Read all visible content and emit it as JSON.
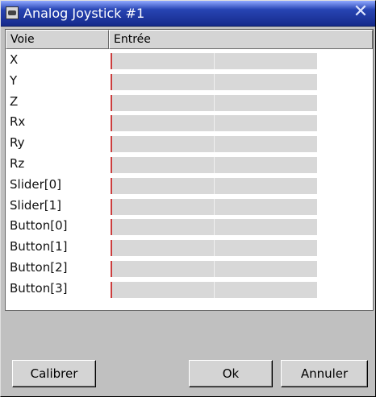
{
  "window": {
    "title": "Analog Joystick #1"
  },
  "list": {
    "headers": {
      "voie": "Voie",
      "entree": "Entrée"
    },
    "rows": [
      {
        "label": "X",
        "level": 0.0
      },
      {
        "label": "Y",
        "level": 0.0
      },
      {
        "label": "Z",
        "level": 0.0
      },
      {
        "label": "Rx",
        "level": 0.0
      },
      {
        "label": "Ry",
        "level": 0.0
      },
      {
        "label": "Rz",
        "level": 0.0
      },
      {
        "label": "Slider[0]",
        "level": 0.0
      },
      {
        "label": "Slider[1]",
        "level": 0.0
      },
      {
        "label": "Button[0]",
        "level": 0.0
      },
      {
        "label": "Button[1]",
        "level": 0.0
      },
      {
        "label": "Button[2]",
        "level": 0.0
      },
      {
        "label": "Button[3]",
        "level": 0.0
      }
    ]
  },
  "buttons": {
    "calibrer": "Calibrer",
    "ok": "Ok",
    "annuler": "Annuler"
  },
  "icons": {
    "title": "joystick-icon",
    "close": "close-icon"
  },
  "colors": {
    "title_start": "#8fa8ff",
    "title_end": "#15298a",
    "bar_marker": "#cc3d3d",
    "bar_track": "#d8d8d8"
  }
}
